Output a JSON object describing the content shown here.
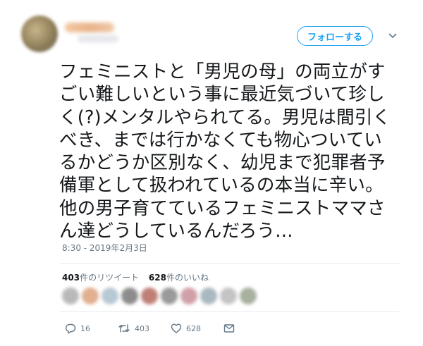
{
  "header": {
    "follow_label": "フォローする"
  },
  "tweet": {
    "text": "フェミニストと「男児の母」の両立がす\nごい難しいという事に最近気づいて珍し\nく(?)メンタルやられてる。男児は間引く\nべき、までは行かなくても物心ついてい\nるかどうか区別なく、幼児まで犯罪者予\n備軍として扱われているの本当に辛い。\n他の男子育てているフェミニストママさ\nん達どうしているんだろう…",
    "timestamp": "8:30 - 2019年2月3日"
  },
  "stats": {
    "retweets_count": "403",
    "retweets_label": "件のリツイート",
    "likes_count": "628",
    "likes_label": "件のいいね"
  },
  "actions": {
    "reply_count": "16",
    "retweet_count": "403",
    "like_count": "628"
  },
  "colors": {
    "accent": "#1da1f2",
    "text": "#14171a",
    "muted": "#657786",
    "divider": "#e6ecf0"
  },
  "icons": [
    "chevron-down-icon",
    "reply-icon",
    "retweet-icon",
    "heart-icon",
    "dm-icon"
  ]
}
